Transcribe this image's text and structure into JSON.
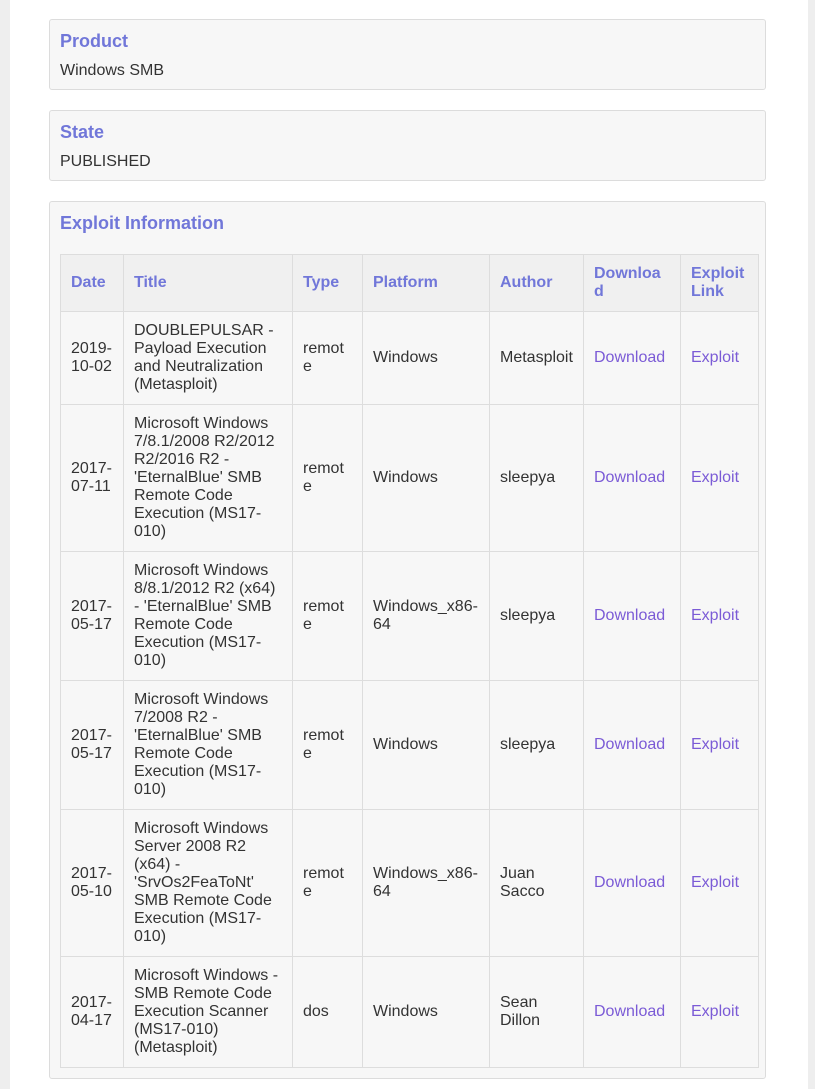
{
  "product": {
    "label": "Product",
    "value": "Windows SMB"
  },
  "state": {
    "label": "State",
    "value": "PUBLISHED"
  },
  "exploit_info": {
    "label": "Exploit Information",
    "columns": [
      "Date",
      "Title",
      "Type",
      "Platform",
      "Author",
      "Download",
      "Exploit Link"
    ],
    "rows": [
      {
        "date": "2019-10-02",
        "title": "DOUBLEPULSAR - Payload Execution and Neutralization (Metasploit)",
        "type": "remote",
        "platform": "Windows",
        "author": "Metasploit",
        "download": "Download",
        "exploit": "Exploit"
      },
      {
        "date": "2017-07-11",
        "title": "Microsoft Windows 7/8.1/2008 R2/2012 R2/2016 R2 - 'EternalBlue' SMB Remote Code Execution (MS17-010)",
        "type": "remote",
        "platform": "Windows",
        "author": "sleepya",
        "download": "Download",
        "exploit": "Exploit"
      },
      {
        "date": "2017-05-17",
        "title": "Microsoft Windows 8/8.1/2012 R2 (x64) - 'EternalBlue' SMB Remote Code Execution (MS17-010)",
        "type": "remote",
        "platform": "Windows_x86-64",
        "author": "sleepya",
        "download": "Download",
        "exploit": "Exploit"
      },
      {
        "date": "2017-05-17",
        "title": "Microsoft Windows 7/2008 R2 - 'EternalBlue' SMB Remote Code Execution (MS17-010)",
        "type": "remote",
        "platform": "Windows",
        "author": "sleepya",
        "download": "Download",
        "exploit": "Exploit"
      },
      {
        "date": "2017-05-10",
        "title": "Microsoft Windows Server 2008 R2 (x64) - 'SrvOs2FeaToNt' SMB Remote Code Execution (MS17-010)",
        "type": "remote",
        "platform": "Windows_x86-64",
        "author": "Juan Sacco",
        "download": "Download",
        "exploit": "Exploit"
      },
      {
        "date": "2017-04-17",
        "title": "Microsoft Windows - SMB Remote Code Execution Scanner (MS17-010) (Metasploit)",
        "type": "dos",
        "platform": "Windows",
        "author": "Sean Dillon",
        "download": "Download",
        "exploit": "Exploit"
      }
    ]
  },
  "colors": {
    "heading": "#7177d9",
    "link": "#7b5bd6",
    "card_bg": "#f7f7f7",
    "page_bg": "#ffffff",
    "outer_bg": "#eeeeee"
  }
}
